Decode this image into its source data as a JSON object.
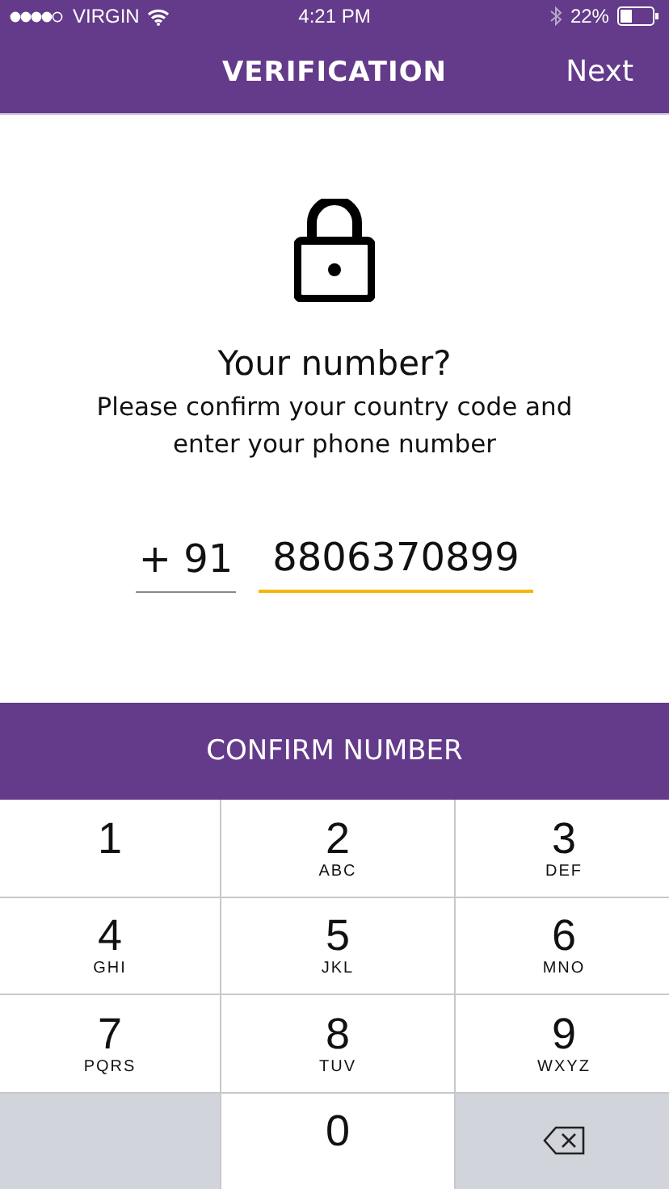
{
  "status_bar": {
    "carrier": "VIRGIN",
    "time": "4:21 PM",
    "battery": "22%"
  },
  "nav": {
    "title": "VERIFICATION",
    "action": "Next"
  },
  "heading": "Your number?",
  "instructions": "Please confirm your country code and enter your phone number",
  "fields": [
    {
      "kind": "code",
      "value": "+ 91",
      "focused": false
    },
    {
      "kind": "phone",
      "value": "8806370899",
      "focused": true
    }
  ],
  "confirm_button": "CONFIRM NUMBER",
  "keypad": [
    {
      "kind": "digit",
      "digit": "1"
    },
    {
      "kind": "digit",
      "digit": "2",
      "letters": "ABC"
    },
    {
      "kind": "digit",
      "digit": "3",
      "letters": "DEF"
    },
    {
      "kind": "digit",
      "digit": "4",
      "letters": "GHI"
    },
    {
      "kind": "digit",
      "digit": "5",
      "letters": "JKL"
    },
    {
      "kind": "digit",
      "digit": "6",
      "letters": "MNO"
    },
    {
      "kind": "digit",
      "digit": "7",
      "letters": "PQRS"
    },
    {
      "kind": "digit",
      "digit": "8",
      "letters": "TUV"
    },
    {
      "kind": "digit",
      "digit": "9",
      "letters": "WXYZ"
    },
    {
      "kind": "blank"
    },
    {
      "kind": "digit",
      "digit": "0"
    },
    {
      "kind": "delete"
    }
  ]
}
